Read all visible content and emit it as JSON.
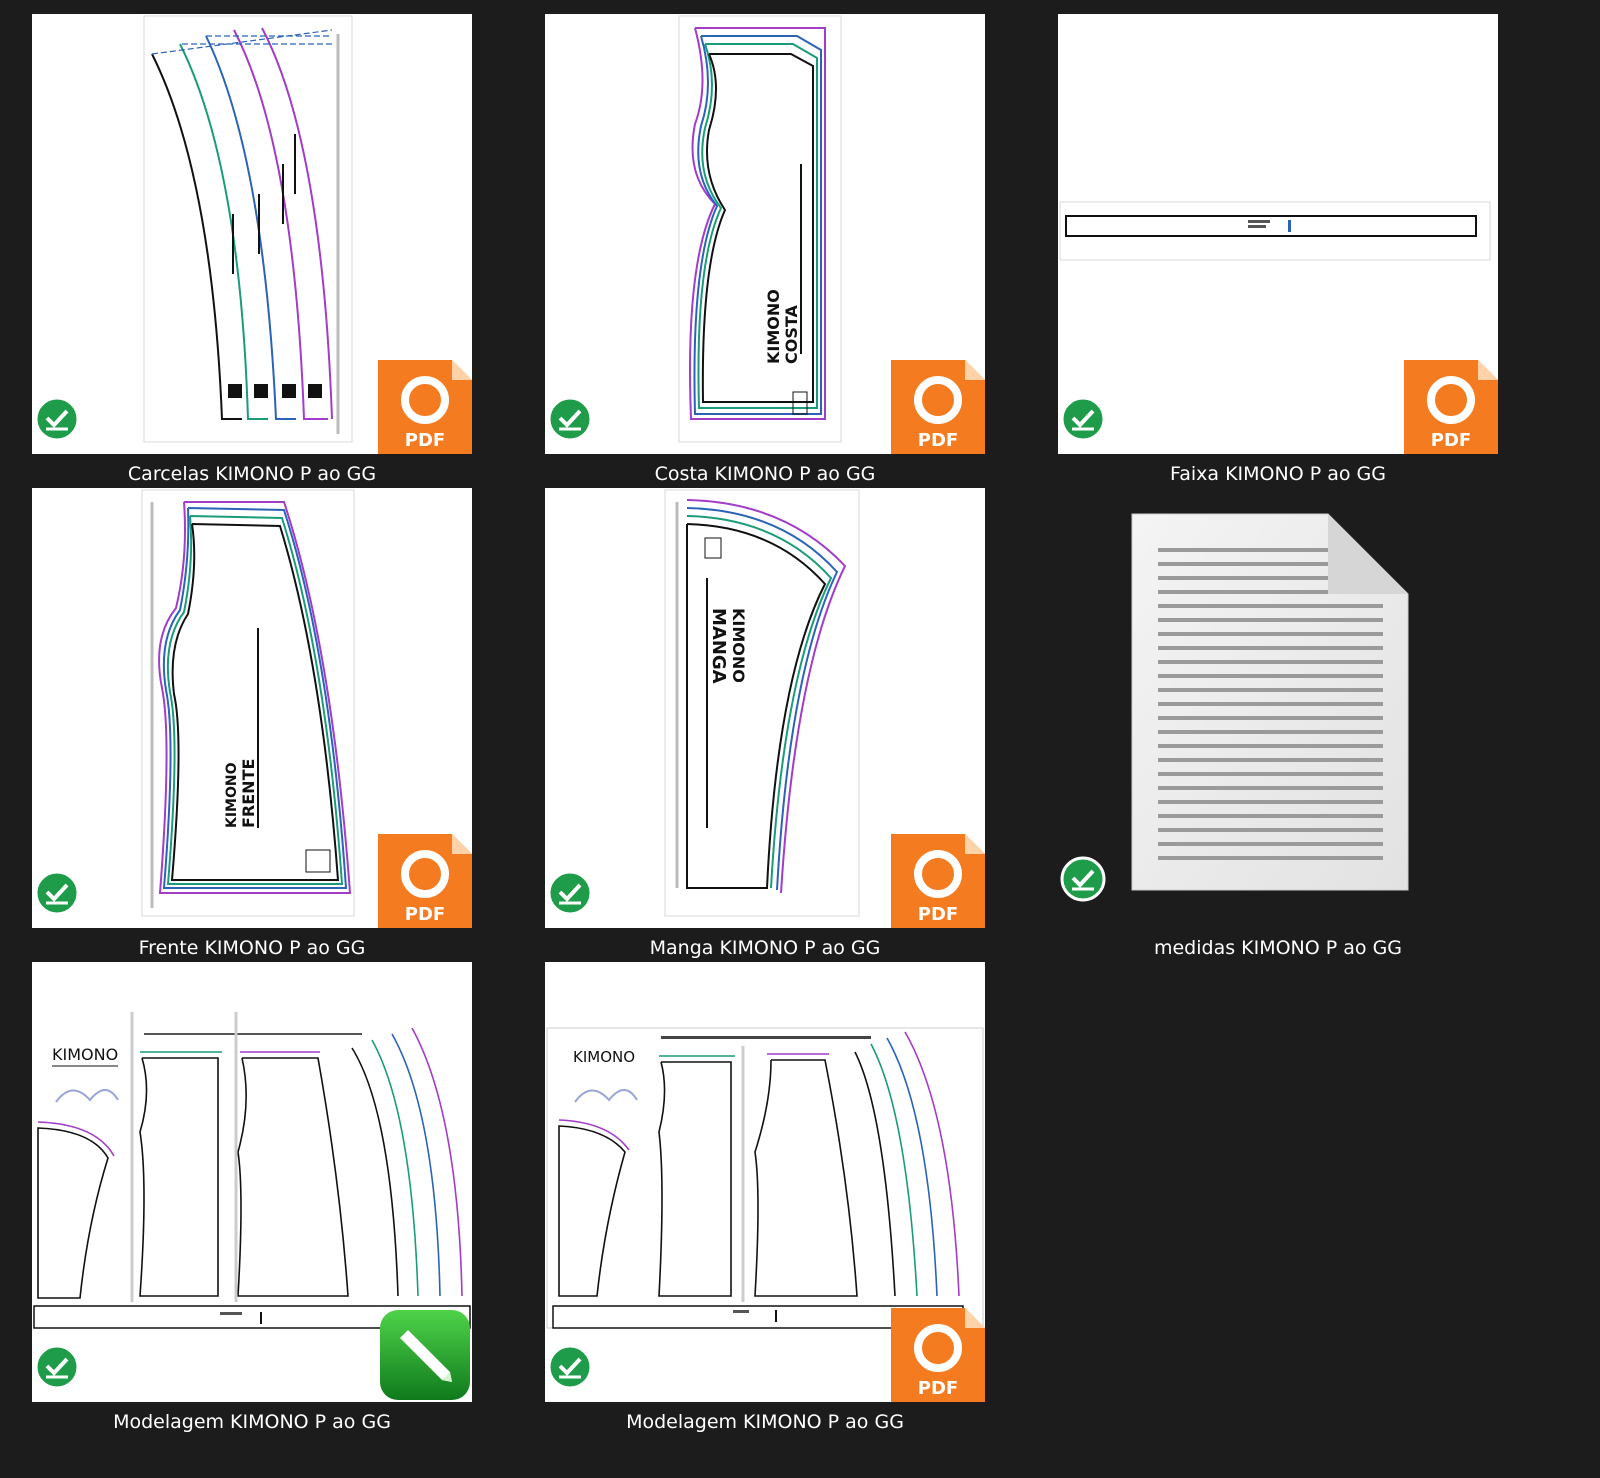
{
  "files": [
    {
      "name": "Carcelas KIMONO P ao GG",
      "type": "pdf"
    },
    {
      "name": "Costa KIMONO P ao GG",
      "type": "pdf"
    },
    {
      "name": "Faixa KIMONO P ao GG",
      "type": "pdf"
    },
    {
      "name": "Frente KIMONO P ao GG",
      "type": "pdf"
    },
    {
      "name": "Manga KIMONO P ao GG",
      "type": "pdf"
    },
    {
      "name": "medidas KIMONO P ao GG",
      "type": "document"
    },
    {
      "name": "Modelagem KIMONO P ao GG",
      "type": "drawing"
    },
    {
      "name": "Modelagem KIMONO P ao GG",
      "type": "pdf"
    }
  ],
  "thumb_text": {
    "kimono": "KIMONO",
    "costa": "COSTA",
    "frente": "FRENTE",
    "manga": "MANGA",
    "pdf_badge": "PDF"
  },
  "colors": {
    "background": "#1c1c1c",
    "pdf_orange": "#f47b20",
    "sync_green": "#1e9c4a",
    "pattern_black": "#111111",
    "pattern_teal": "#1a9c7a",
    "pattern_blue": "#2a63b8",
    "pattern_purple": "#a23cc9"
  },
  "icons": {
    "sync_status": "check-circle-icon",
    "pdf_app": "foxit-pdf-icon",
    "drawing_app": "pencil-icon",
    "document": "text-document-icon"
  }
}
